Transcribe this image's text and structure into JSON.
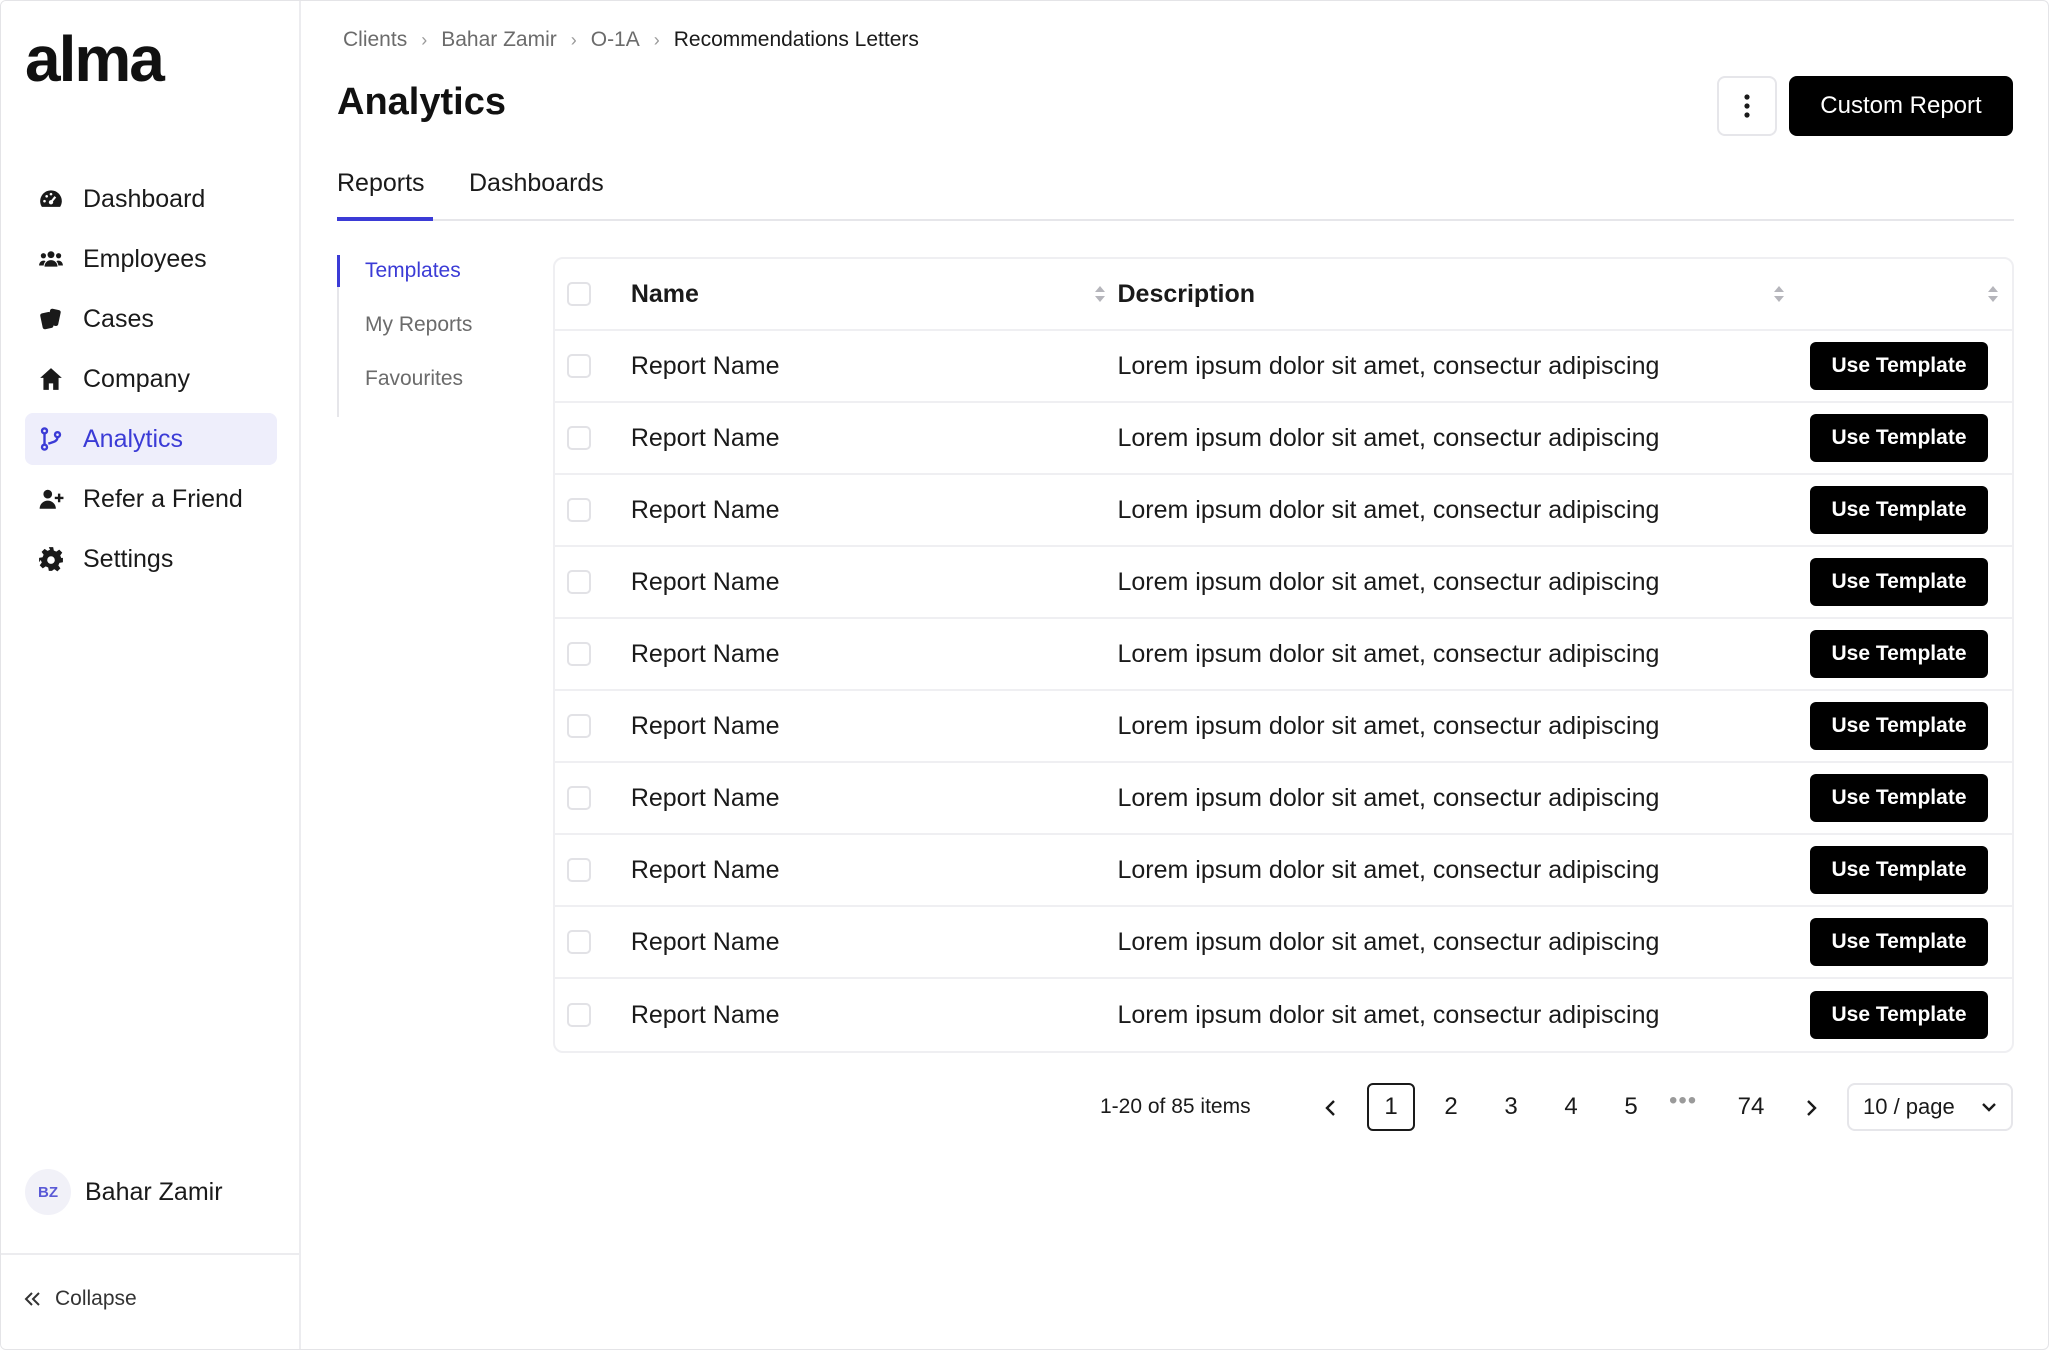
{
  "brand": {
    "logo": "alma",
    "accent": "#3b3bd6"
  },
  "sidebar": {
    "items": [
      {
        "label": "Dashboard",
        "icon": "gauge-icon"
      },
      {
        "label": "Employees",
        "icon": "users-icon"
      },
      {
        "label": "Cases",
        "icon": "cards-icon"
      },
      {
        "label": "Company",
        "icon": "home-icon"
      },
      {
        "label": "Analytics",
        "icon": "branch-icon",
        "active": true
      },
      {
        "label": "Refer a Friend",
        "icon": "user-plus-icon"
      },
      {
        "label": "Settings",
        "icon": "gear-icon"
      }
    ],
    "user": {
      "initials": "BZ",
      "name": "Bahar Zamir"
    },
    "collapse_label": "Collapse"
  },
  "breadcrumb": [
    "Clients",
    "Bahar Zamir",
    "O-1A",
    "Recommendations Letters"
  ],
  "page": {
    "title": "Analytics",
    "custom_report_label": "Custom Report"
  },
  "tabs": [
    {
      "label": "Reports",
      "active": true
    },
    {
      "label": "Dashboards",
      "active": false
    }
  ],
  "subnav": [
    {
      "label": "Templates",
      "active": true
    },
    {
      "label": "My Reports",
      "active": false
    },
    {
      "label": "Favourites",
      "active": false
    }
  ],
  "table": {
    "columns": {
      "name": "Name",
      "description": "Description"
    },
    "rows": [
      {
        "name": "Report Name",
        "description": "Lorem ipsum dolor sit amet, consectur adipiscing",
        "action": "Use Template"
      },
      {
        "name": "Report Name",
        "description": "Lorem ipsum dolor sit amet, consectur adipiscing",
        "action": "Use Template"
      },
      {
        "name": "Report Name",
        "description": "Lorem ipsum dolor sit amet, consectur adipiscing",
        "action": "Use Template"
      },
      {
        "name": "Report Name",
        "description": "Lorem ipsum dolor sit amet, consectur adipiscing",
        "action": "Use Template"
      },
      {
        "name": "Report Name",
        "description": "Lorem ipsum dolor sit amet, consectur adipiscing",
        "action": "Use Template"
      },
      {
        "name": "Report Name",
        "description": "Lorem ipsum dolor sit amet, consectur adipiscing",
        "action": "Use Template"
      },
      {
        "name": "Report Name",
        "description": "Lorem ipsum dolor sit amet, consectur adipiscing",
        "action": "Use Template"
      },
      {
        "name": "Report Name",
        "description": "Lorem ipsum dolor sit amet, consectur adipiscing",
        "action": "Use Template"
      },
      {
        "name": "Report Name",
        "description": "Lorem ipsum dolor sit amet, consectur adipiscing",
        "action": "Use Template"
      },
      {
        "name": "Report Name",
        "description": "Lorem ipsum dolor sit amet, consectur adipiscing",
        "action": "Use Template"
      }
    ]
  },
  "pagination": {
    "info": "1-20 of 85 items",
    "pages": [
      "1",
      "2",
      "3",
      "4",
      "5"
    ],
    "current": "1",
    "ellipsis": "•••",
    "last": "74",
    "page_size": "10 / page"
  }
}
